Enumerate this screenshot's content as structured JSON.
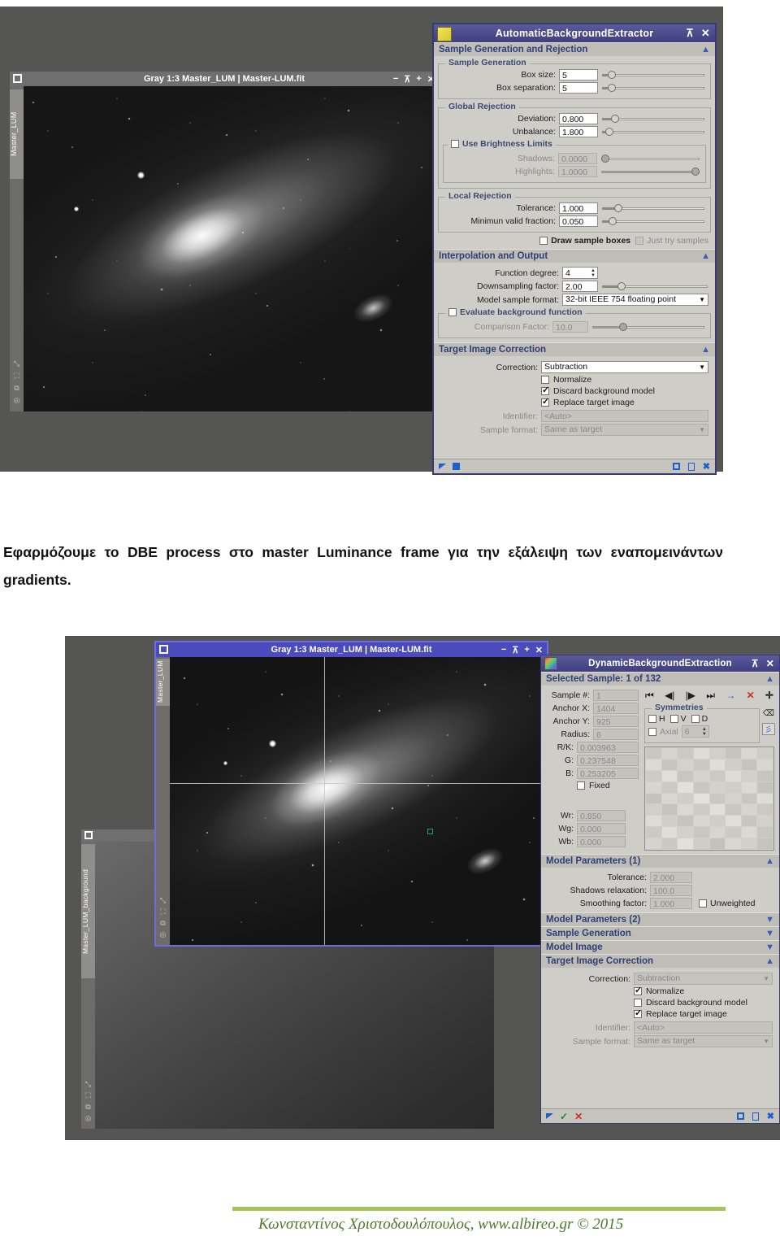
{
  "colors": {
    "title_bar": "#4a4a8f",
    "panel_bg": "#cfcdc8",
    "section_head_text": "#2d3f7a",
    "accent_blue": "#2f5fbf",
    "accent_red": "#d03020",
    "accent_green": "#27ab4e",
    "image_title_blue": "#4b4bbd",
    "footer_green": "#4e7a2e",
    "footer_rule": "#a8c25c"
  },
  "body_text": {
    "paragraph": "Εφαρμόζουμε το DBE process στο master Luminance frame για την εξάλειψη των εναπομεινάντων gradients."
  },
  "footer": {
    "credit": "Κωνσταντίνος Χριστοδουλόπουλος, www.albireo.gr © 2015"
  },
  "top_screenshot": {
    "image_window": {
      "title": "Gray 1:3 Master_LUM | Master-LUM.fit",
      "tab_label": "Master_LUM",
      "buttons": [
        "−",
        "⊼",
        "+",
        "✕"
      ]
    },
    "abe_dialog": {
      "title": "AutomaticBackgroundExtractor",
      "title_buttons": [
        "⊼",
        "✕"
      ],
      "sections": [
        {
          "name": "Sample Generation and Rejection",
          "collapse_icon": "collapse-up",
          "groups": [
            {
              "name": "Sample Generation",
              "fields": [
                {
                  "label": "Box size:",
                  "value": "5",
                  "slider": 0.03
                },
                {
                  "label": "Box separation:",
                  "value": "5",
                  "slider": 0.03
                }
              ]
            },
            {
              "name": "Global Rejection",
              "fields": [
                {
                  "label": "Deviation:",
                  "value": "0.800",
                  "slider": 0.06
                },
                {
                  "label": "Unbalance:",
                  "value": "1.800",
                  "slider": 0.03
                }
              ],
              "subgroup": {
                "name": "Use Brightness Limits",
                "checked": false,
                "fields": [
                  {
                    "label": "Shadows:",
                    "value": "0.0000",
                    "slider": 0.0,
                    "disabled": true
                  },
                  {
                    "label": "Highlights:",
                    "value": "1.0000",
                    "slider": 1.0,
                    "disabled": true
                  }
                ]
              }
            },
            {
              "name": "Local Rejection",
              "fields": [
                {
                  "label": "Tolerance:",
                  "value": "1.000",
                  "slider": 0.1
                },
                {
                  "label": "Minimun valid fraction:",
                  "value": "0.050",
                  "slider": 0.05
                }
              ]
            }
          ],
          "checkboxes": [
            {
              "label": "Draw sample boxes",
              "checked": false,
              "disabled": false
            },
            {
              "label": "Just try samples",
              "checked": false,
              "disabled": true
            }
          ]
        },
        {
          "name": "Interpolation and Output",
          "collapse_icon": "collapse-up",
          "fields": [
            {
              "label": "Function degree:",
              "value": "4",
              "type": "spin"
            },
            {
              "label": "Downsampling factor:",
              "value": "2.00",
              "type": "slider",
              "slider": 0.12
            },
            {
              "label": "Model sample format:",
              "value": "32-bit IEEE 754 floating point",
              "type": "select"
            }
          ],
          "subgroup": {
            "name": "Evaluate background function",
            "checked": false,
            "fields": [
              {
                "label": "Comparison Factor:",
                "value": "10.0",
                "slider": 0.22,
                "disabled": true
              }
            ]
          }
        },
        {
          "name": "Target Image Correction",
          "collapse_icon": "collapse-up",
          "fields": [
            {
              "label": "Correction:",
              "value": "Subtraction",
              "type": "select"
            },
            {
              "label": "Identifier:",
              "value": "<Auto>",
              "type": "text",
              "disabled": true
            },
            {
              "label": "Sample format:",
              "value": "Same as target",
              "type": "select",
              "disabled": true
            }
          ],
          "checkboxes": [
            {
              "label": "Normalize",
              "checked": false
            },
            {
              "label": "Discard background model",
              "checked": true
            },
            {
              "label": "Replace target image",
              "checked": true
            }
          ]
        }
      ],
      "bottom_bar": {
        "left_icons": [
          "apply-triangle-icon",
          "apply-global-square-icon"
        ],
        "right_icons": [
          "new-instance-icon",
          "browse-documentation-icon",
          "reset-icon"
        ]
      }
    }
  },
  "bottom_screenshot": {
    "image_window": {
      "title": "Gray 1:3 Master_LUM | Master-LUM.fit",
      "tab_label": "Master_LUM",
      "buttons": [
        "−",
        "⊼",
        "+",
        "✕"
      ]
    },
    "background_window": {
      "tab_label": "Master_LUM_background"
    },
    "dbe_dialog": {
      "title": "DynamicBackgroundExtraction",
      "title_buttons": [
        "⊼",
        "✕"
      ],
      "selected_sample_header": "Selected Sample: 1 of 132",
      "fields": [
        {
          "label": "Sample #:",
          "value": "1"
        },
        {
          "label": "Anchor X:",
          "value": "1404"
        },
        {
          "label": "Anchor Y:",
          "value": "925"
        },
        {
          "label": "Radius:",
          "value": "6"
        },
        {
          "label": "R/K:",
          "value": "0.003963"
        },
        {
          "label": "G:",
          "value": "0.237548"
        },
        {
          "label": "B:",
          "value": "0.253205"
        },
        {
          "label": "Wr:",
          "value": "0.850"
        },
        {
          "label": "Wg:",
          "value": "0.000"
        },
        {
          "label": "Wb:",
          "value": "0.000"
        }
      ],
      "fixed_checkbox": {
        "label": "Fixed",
        "checked": false
      },
      "nav_icons": [
        "first-sample-icon",
        "prev-sample-icon",
        "next-sample-icon",
        "last-sample-icon",
        "goto-sample-icon",
        "delete-sample-icon",
        "center-sample-icon"
      ],
      "symmetries": {
        "name": "Symmetries",
        "checkboxes": [
          {
            "label": "H",
            "checked": false
          },
          {
            "label": "V",
            "checked": false
          },
          {
            "label": "D",
            "checked": false
          },
          {
            "label": "Axial",
            "checked": false
          }
        ],
        "axial_value": "6",
        "side_icons": [
          "delete-symmetries-icon",
          "generate-symmetries-icon"
        ]
      },
      "sections": [
        {
          "name": "Model Parameters (1)",
          "collapse_icon": "collapse-up",
          "fields": [
            {
              "label": "Tolerance:",
              "value": "2.000"
            },
            {
              "label": "Shadows relaxation:",
              "value": "100.0"
            },
            {
              "label": "Smoothing factor:",
              "value": "1.000"
            }
          ],
          "checkbox": {
            "label": "Unweighted",
            "checked": false
          }
        },
        {
          "name": "Model Parameters (2)",
          "collapse_icon": "expand-down"
        },
        {
          "name": "Sample Generation",
          "collapse_icon": "expand-down"
        },
        {
          "name": "Model Image",
          "collapse_icon": "expand-down"
        },
        {
          "name": "Target Image Correction",
          "collapse_icon": "collapse-up",
          "fields": [
            {
              "label": "Correction:",
              "value": "Subtraction",
              "type": "select"
            },
            {
              "label": "Identifier:",
              "value": "<Auto>",
              "type": "text",
              "disabled": true
            },
            {
              "label": "Sample format:",
              "value": "Same as target",
              "type": "select",
              "disabled": true
            }
          ],
          "checkboxes": [
            {
              "label": "Normalize",
              "checked": true
            },
            {
              "label": "Discard background model",
              "checked": false
            },
            {
              "label": "Replace target image",
              "checked": true
            }
          ]
        }
      ],
      "bottom_bar": {
        "left_icons": [
          "apply-triangle-icon",
          "ok-check-icon",
          "cancel-cross-icon"
        ],
        "right_icons": [
          "new-instance-icon",
          "browse-documentation-icon",
          "reset-icon"
        ]
      }
    }
  }
}
